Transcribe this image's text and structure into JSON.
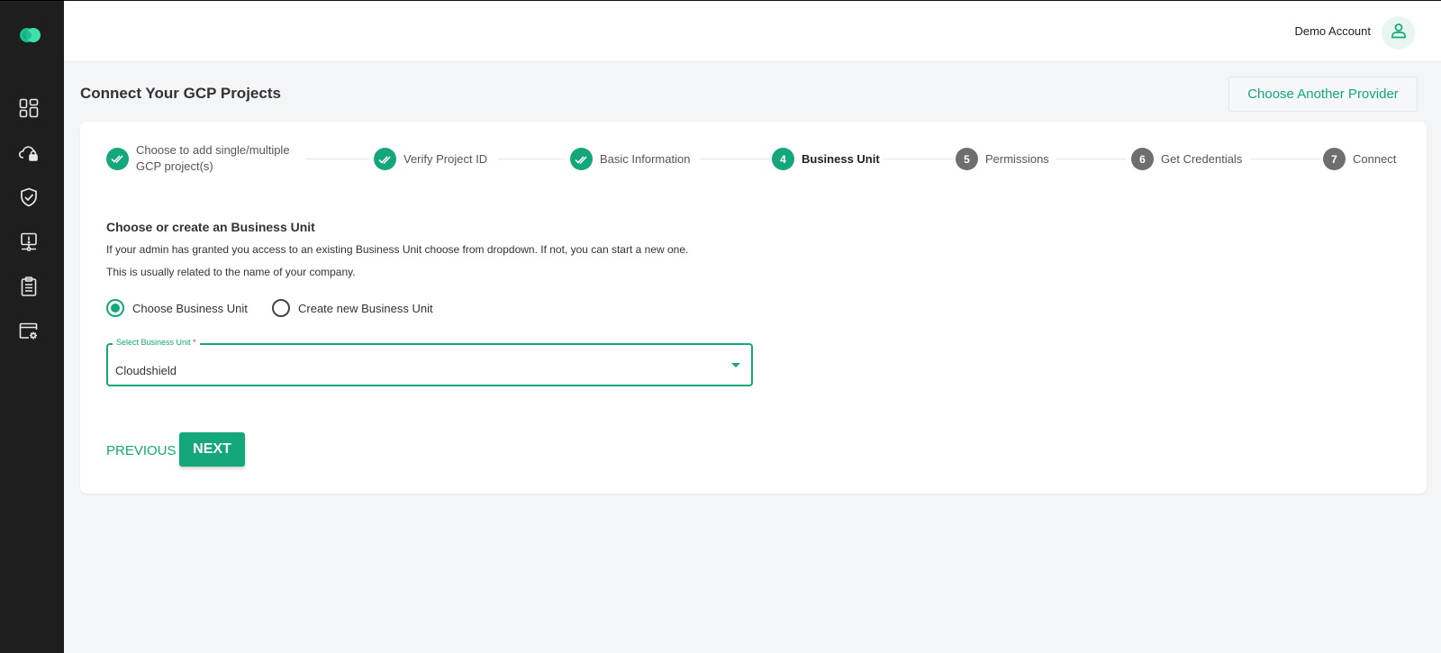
{
  "sidebar": {
    "logo": "cloud-logo",
    "items": [
      {
        "icon": "dashboard-icon"
      },
      {
        "icon": "cloud-lock-icon"
      },
      {
        "icon": "shield-check-icon"
      },
      {
        "icon": "alert-monitor-icon"
      },
      {
        "icon": "clipboard-icon"
      },
      {
        "icon": "window-settings-icon"
      }
    ]
  },
  "header": {
    "account_name": "Demo Account",
    "avatar_icon": "user-icon"
  },
  "page": {
    "title": "Connect Your GCP Projects",
    "provider_button": "Choose Another Provider"
  },
  "stepper": {
    "steps": [
      {
        "label": "Choose to add single/multiple GCP project(s)",
        "line1": "Choose to add single/multiple",
        "line2": "GCP project(s)",
        "status": "done"
      },
      {
        "label": "Verify Project ID",
        "status": "done"
      },
      {
        "label": "Basic Information",
        "status": "done"
      },
      {
        "number": "4",
        "label": "Business Unit",
        "status": "active"
      },
      {
        "number": "5",
        "label": "Permissions",
        "status": "todo"
      },
      {
        "number": "6",
        "label": "Get Credentials",
        "status": "todo"
      },
      {
        "number": "7",
        "label": "Connect",
        "status": "todo"
      }
    ]
  },
  "form": {
    "section_title": "Choose or create an Business Unit",
    "description_line1": "If your admin has granted you access to an existing Business Unit choose from dropdown. If not, you can start a new one.",
    "description_line2": "This is usually related to the name of your company.",
    "radio_options": [
      {
        "label": "Choose Business Unit",
        "selected": true
      },
      {
        "label": "Create new Business Unit",
        "selected": false
      }
    ],
    "select": {
      "label": "Select Business Unit",
      "required_mark": "*",
      "value": "Cloudshield"
    },
    "previous_label": "PREVIOUS",
    "next_label": "NEXT"
  },
  "colors": {
    "accent": "#13a77b",
    "sidebar_bg": "#1e1e1e",
    "page_bg": "#f4f5f7",
    "step_todo": "#6e6e6e"
  }
}
